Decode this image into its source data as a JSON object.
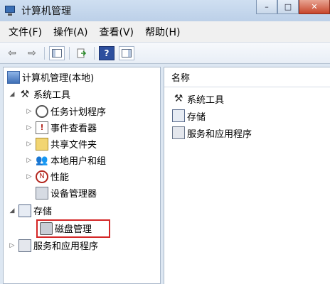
{
  "window": {
    "title": "计算机管理",
    "buttons": {
      "minimize": "–",
      "maximize": "□",
      "close": "✕"
    }
  },
  "menu": {
    "items": [
      "文件(F)",
      "操作(A)",
      "查看(V)",
      "帮助(H)"
    ]
  },
  "toolbar": {
    "back": "⇦",
    "forward": "⇨",
    "help": "?"
  },
  "tree": {
    "root": "计算机管理(本地)",
    "system_tools": "系统工具",
    "task_scheduler": "任务计划程序",
    "event_viewer": "事件查看器",
    "shared_folders": "共享文件夹",
    "local_users": "本地用户和组",
    "performance": "性能",
    "device_manager": "设备管理器",
    "storage": "存储",
    "disk_management": "磁盘管理",
    "services_apps": "服务和应用程序",
    "expanded_glyph": "◢",
    "collapsed_glyph": "▷"
  },
  "right_pane": {
    "column_header": "名称",
    "items": [
      "系统工具",
      "存储",
      "服务和应用程序"
    ]
  },
  "colors": {
    "highlight_border": "#d42626"
  }
}
